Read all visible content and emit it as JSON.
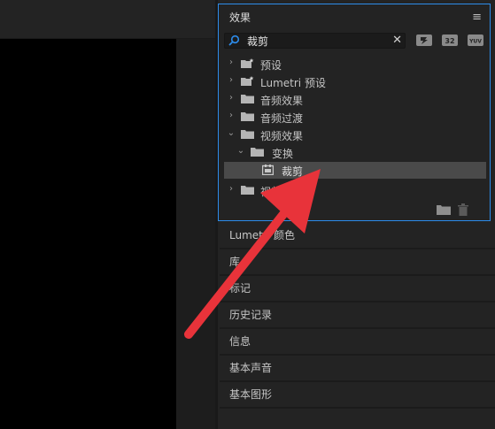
{
  "effects_panel": {
    "title": "效果",
    "menu_glyph": "≡",
    "search": {
      "value": "裁剪",
      "clear_glyph": "✕"
    },
    "filter_icons": [
      "accelerated-effects-icon",
      "32bit-effects-icon",
      "yuv-effects-icon"
    ],
    "filter_labels": [
      "",
      "32",
      "YUV"
    ],
    "tree": [
      {
        "label": "预设",
        "chevron": "›",
        "icon": "preset-folder-icon"
      },
      {
        "label": "Lumetri 预设",
        "chevron": "›",
        "icon": "preset-folder-icon"
      },
      {
        "label": "音频效果",
        "chevron": "›",
        "icon": "folder-icon"
      },
      {
        "label": "音频过渡",
        "chevron": "›",
        "icon": "folder-icon"
      },
      {
        "label": "视频效果",
        "chevron": "⌄",
        "icon": "folder-icon"
      },
      {
        "label": "变换",
        "chevron": "⌄",
        "icon": "folder-icon"
      },
      {
        "label": "裁剪",
        "chevron": "",
        "icon": "effect-icon"
      },
      {
        "label": "视频过渡",
        "chevron": "›",
        "icon": "folder-icon"
      }
    ]
  },
  "collapsed_panels": [
    "Lumetri 颜色",
    "库",
    "标记",
    "历史记录",
    "信息",
    "基本声音",
    "基本图形"
  ],
  "colors": {
    "accent": "#2d8ceb",
    "arrow": "#e8333a",
    "selection": "#4a4a4a"
  }
}
